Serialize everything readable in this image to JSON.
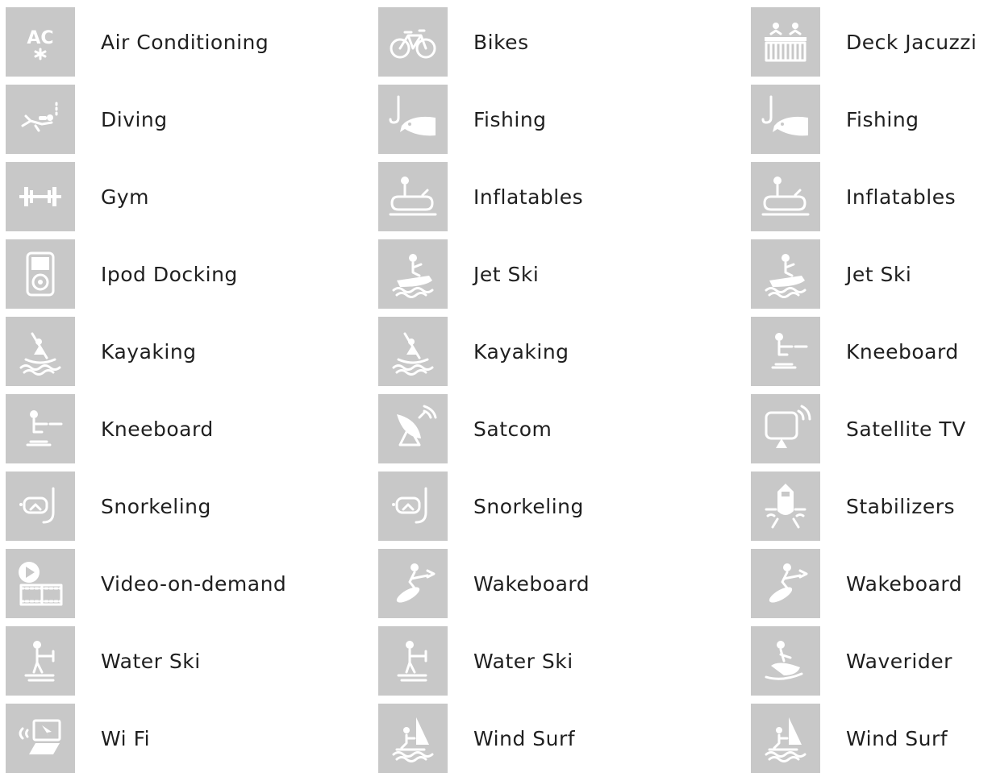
{
  "columns": [
    {
      "items": [
        {
          "label": "Air Conditioning",
          "icon": "air-conditioning-icon"
        },
        {
          "label": "Diving",
          "icon": "diving-icon"
        },
        {
          "label": "Gym",
          "icon": "gym-icon"
        },
        {
          "label": "Ipod Docking",
          "icon": "ipod-docking-icon"
        },
        {
          "label": "Kayaking",
          "icon": "kayaking-icon"
        },
        {
          "label": "Kneeboard",
          "icon": "kneeboard-icon"
        },
        {
          "label": "Snorkeling",
          "icon": "snorkeling-icon"
        },
        {
          "label": "Video-on-demand",
          "icon": "video-on-demand-icon"
        },
        {
          "label": "Water Ski",
          "icon": "water-ski-icon"
        },
        {
          "label": "Wi Fi",
          "icon": "wifi-icon"
        }
      ]
    },
    {
      "items": [
        {
          "label": "Bikes",
          "icon": "bikes-icon"
        },
        {
          "label": "Fishing",
          "icon": "fishing-icon"
        },
        {
          "label": "Inflatables",
          "icon": "inflatables-icon"
        },
        {
          "label": "Jet Ski",
          "icon": "jet-ski-icon"
        },
        {
          "label": "Kayaking",
          "icon": "kayaking-icon"
        },
        {
          "label": "Satcom",
          "icon": "satcom-icon"
        },
        {
          "label": "Snorkeling",
          "icon": "snorkeling-icon"
        },
        {
          "label": "Wakeboard",
          "icon": "wakeboard-icon"
        },
        {
          "label": "Water Ski",
          "icon": "water-ski-icon"
        },
        {
          "label": "Wind Surf",
          "icon": "wind-surf-icon"
        }
      ]
    },
    {
      "items": [
        {
          "label": "Deck Jacuzzi",
          "icon": "deck-jacuzzi-icon"
        },
        {
          "label": "Fishing",
          "icon": "fishing-icon"
        },
        {
          "label": "Inflatables",
          "icon": "inflatables-icon"
        },
        {
          "label": "Jet Ski",
          "icon": "jet-ski-icon"
        },
        {
          "label": "Kneeboard",
          "icon": "kneeboard-icon"
        },
        {
          "label": "Satellite TV",
          "icon": "satellite-tv-icon"
        },
        {
          "label": "Stabilizers",
          "icon": "stabilizers-icon"
        },
        {
          "label": "Wakeboard",
          "icon": "wakeboard-icon"
        },
        {
          "label": "Waverider",
          "icon": "waverider-icon"
        },
        {
          "label": "Wind Surf",
          "icon": "wind-surf-icon"
        }
      ]
    }
  ],
  "colors": {
    "tile": "#c8c8c8",
    "icon": "#ffffff",
    "text": "#1f1f1f"
  },
  "ac_text": "AC"
}
